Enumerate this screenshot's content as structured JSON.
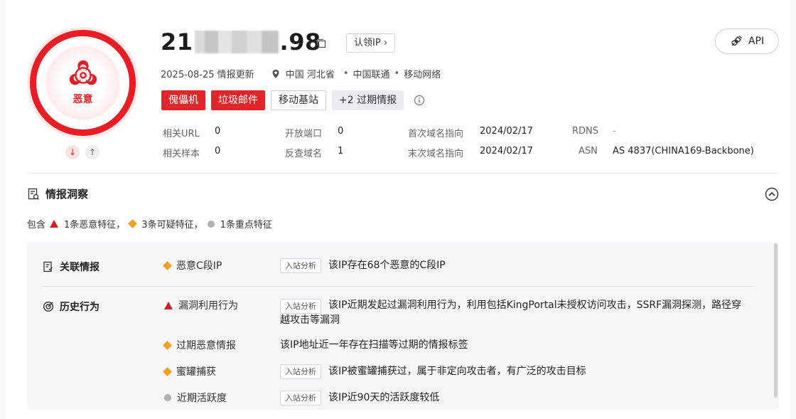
{
  "verdict": {
    "label": "恶意",
    "color": "#e21d24"
  },
  "ip": {
    "prefix": "21",
    "suffix": ".98",
    "claim_label": "认领IP",
    "claim_chevron": "›"
  },
  "api_label": "API",
  "meta": {
    "updated": "2025-08-25 情报更新",
    "location": "中国 河北省",
    "sep1": "•",
    "isp": "中国联通",
    "sep2": "•",
    "network": "移动网络"
  },
  "tags": [
    {
      "label": "傀儡机",
      "style": "red"
    },
    {
      "label": "垃圾邮件",
      "style": "red"
    },
    {
      "label": "移动基站",
      "style": "outline"
    },
    {
      "label": "+2 过期情报",
      "style": "grey"
    }
  ],
  "stats": {
    "related_url": {
      "label": "相关URL",
      "value": "0"
    },
    "related_sample": {
      "label": "相关样本",
      "value": "0"
    },
    "open_ports": {
      "label": "开放端口",
      "value": "0"
    },
    "reverse_domain": {
      "label": "反查域名",
      "value": "1"
    },
    "first_domain": {
      "label": "首次域名指向",
      "value": "2024/02/17"
    },
    "last_domain": {
      "label": "末次域名指向",
      "value": "2024/02/17"
    },
    "rdns": {
      "label": "RDNS",
      "value": "-"
    },
    "asn": {
      "label": "ASN",
      "value": "AS 4837(CHINA169-Backbone)"
    }
  },
  "insight": {
    "title": "情报洞察",
    "summary": {
      "prefix": "包含",
      "malicious": "1条恶意特征，",
      "suspicious": "3条可疑特征，",
      "key": "1条重点特征"
    },
    "categories": {
      "related": "关联情报",
      "history": "历史行为"
    },
    "features": [
      {
        "name": "恶意C段IP",
        "level": "suspicious",
        "analysis": "入站分析",
        "desc": "该IP存在68个恶意的C段IP"
      },
      {
        "name": "漏洞利用行为",
        "level": "malicious",
        "analysis": "入站分析",
        "desc": "该IP近期发起过漏洞利用行为，利用包括KingPortal未授权访问攻击，SSRF漏洞探测，路径穿越攻击等漏洞"
      },
      {
        "name": "过期恶意情报",
        "level": "suspicious",
        "analysis": "",
        "desc": "该IP地址近一年存在扫描等过期的情报标签"
      },
      {
        "name": "蜜罐捕获",
        "level": "suspicious",
        "analysis": "入站分析",
        "desc": "该IP被蜜罐捕获过，属于非定向攻击者，有广泛的攻击目标"
      },
      {
        "name": "近期活跃度",
        "level": "key",
        "analysis": "入站分析",
        "desc": "该IP近90天的活跃度较低"
      }
    ]
  },
  "colors": {
    "malicious": "#d11f25",
    "suspicious": "#f0a020",
    "key": "#b0b0b8",
    "accent_red": "#e0262b"
  }
}
